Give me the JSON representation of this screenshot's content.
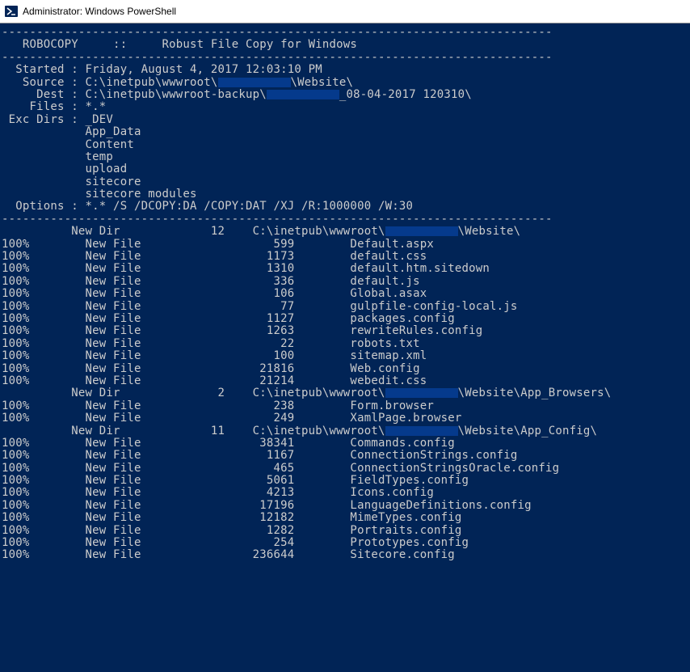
{
  "window": {
    "title": "Administrator: Windows PowerShell",
    "icon": "powershell-icon"
  },
  "robocopy": {
    "banner_label": "ROBOCOPY     ::     Robust File Copy for Windows",
    "started_label": "Started",
    "started_value": "Friday, August 4, 2017 12:03:10 PM",
    "source_label": "Source",
    "source_prefix": "C:\\inetpub\\wwwroot\\",
    "source_suffix": "\\Website\\",
    "dest_label": "Dest",
    "dest_prefix": "C:\\inetpub\\wwwroot-backup\\",
    "dest_suffix": "_08-04-2017 120310\\",
    "files_label": "Files",
    "files_value": "*.*",
    "exc_dirs_label": "Exc Dirs",
    "exc_dirs": [
      "_DEV",
      "App_Data",
      "Content",
      "temp",
      "upload",
      "sitecore",
      "sitecore modules"
    ],
    "options_label": "Options",
    "options_value": "*.* /S /DCOPY:DA /COPY:DAT /XJ /R:1000000 /W:30"
  },
  "output": {
    "dir1": {
      "label": "New Dir",
      "count": "12",
      "path_prefix": "C:\\inetpub\\wwwroot\\",
      "path_suffix": "\\Website\\"
    },
    "files1": [
      {
        "pct": "100%",
        "label": "New File",
        "size": "599",
        "name": "Default.aspx"
      },
      {
        "pct": "100%",
        "label": "New File",
        "size": "1173",
        "name": "default.css"
      },
      {
        "pct": "100%",
        "label": "New File",
        "size": "1310",
        "name": "default.htm.sitedown"
      },
      {
        "pct": "100%",
        "label": "New File",
        "size": "336",
        "name": "default.js"
      },
      {
        "pct": "100%",
        "label": "New File",
        "size": "106",
        "name": "Global.asax"
      },
      {
        "pct": "100%",
        "label": "New File",
        "size": "77",
        "name": "gulpfile-config-local.js"
      },
      {
        "pct": "100%",
        "label": "New File",
        "size": "1127",
        "name": "packages.config"
      },
      {
        "pct": "100%",
        "label": "New File",
        "size": "1263",
        "name": "rewriteRules.config"
      },
      {
        "pct": "100%",
        "label": "New File",
        "size": "22",
        "name": "robots.txt"
      },
      {
        "pct": "100%",
        "label": "New File",
        "size": "100",
        "name": "sitemap.xml"
      },
      {
        "pct": "100%",
        "label": "New File",
        "size": "21816",
        "name": "Web.config"
      },
      {
        "pct": "100%",
        "label": "New File",
        "size": "21214",
        "name": "webedit.css"
      }
    ],
    "dir2": {
      "label": "New Dir",
      "count": "2",
      "path_prefix": "C:\\inetpub\\wwwroot\\",
      "path_suffix": "\\Website\\App_Browsers\\"
    },
    "files2": [
      {
        "pct": "100%",
        "label": "New File",
        "size": "238",
        "name": "Form.browser"
      },
      {
        "pct": "100%",
        "label": "New File",
        "size": "249",
        "name": "XamlPage.browser"
      }
    ],
    "dir3": {
      "label": "New Dir",
      "count": "11",
      "path_prefix": "C:\\inetpub\\wwwroot\\",
      "path_suffix": "\\Website\\App_Config\\"
    },
    "files3": [
      {
        "pct": "100%",
        "label": "New File",
        "size": "38341",
        "name": "Commands.config"
      },
      {
        "pct": "100%",
        "label": "New File",
        "size": "1167",
        "name": "ConnectionStrings.config"
      },
      {
        "pct": "100%",
        "label": "New File",
        "size": "465",
        "name": "ConnectionStringsOracle.config"
      },
      {
        "pct": "100%",
        "label": "New File",
        "size": "5061",
        "name": "FieldTypes.config"
      },
      {
        "pct": "100%",
        "label": "New File",
        "size": "4213",
        "name": "Icons.config"
      },
      {
        "pct": "100%",
        "label": "New File",
        "size": "17196",
        "name": "LanguageDefinitions.config"
      },
      {
        "pct": "100%",
        "label": "New File",
        "size": "12182",
        "name": "MimeTypes.config"
      },
      {
        "pct": "100%",
        "label": "New File",
        "size": "1282",
        "name": "Portraits.config"
      },
      {
        "pct": "100%",
        "label": "New File",
        "size": "254",
        "name": "Prototypes.config"
      },
      {
        "pct": "100%",
        "label": "New File",
        "size": "236644",
        "name": "Sitecore.config"
      }
    ]
  }
}
